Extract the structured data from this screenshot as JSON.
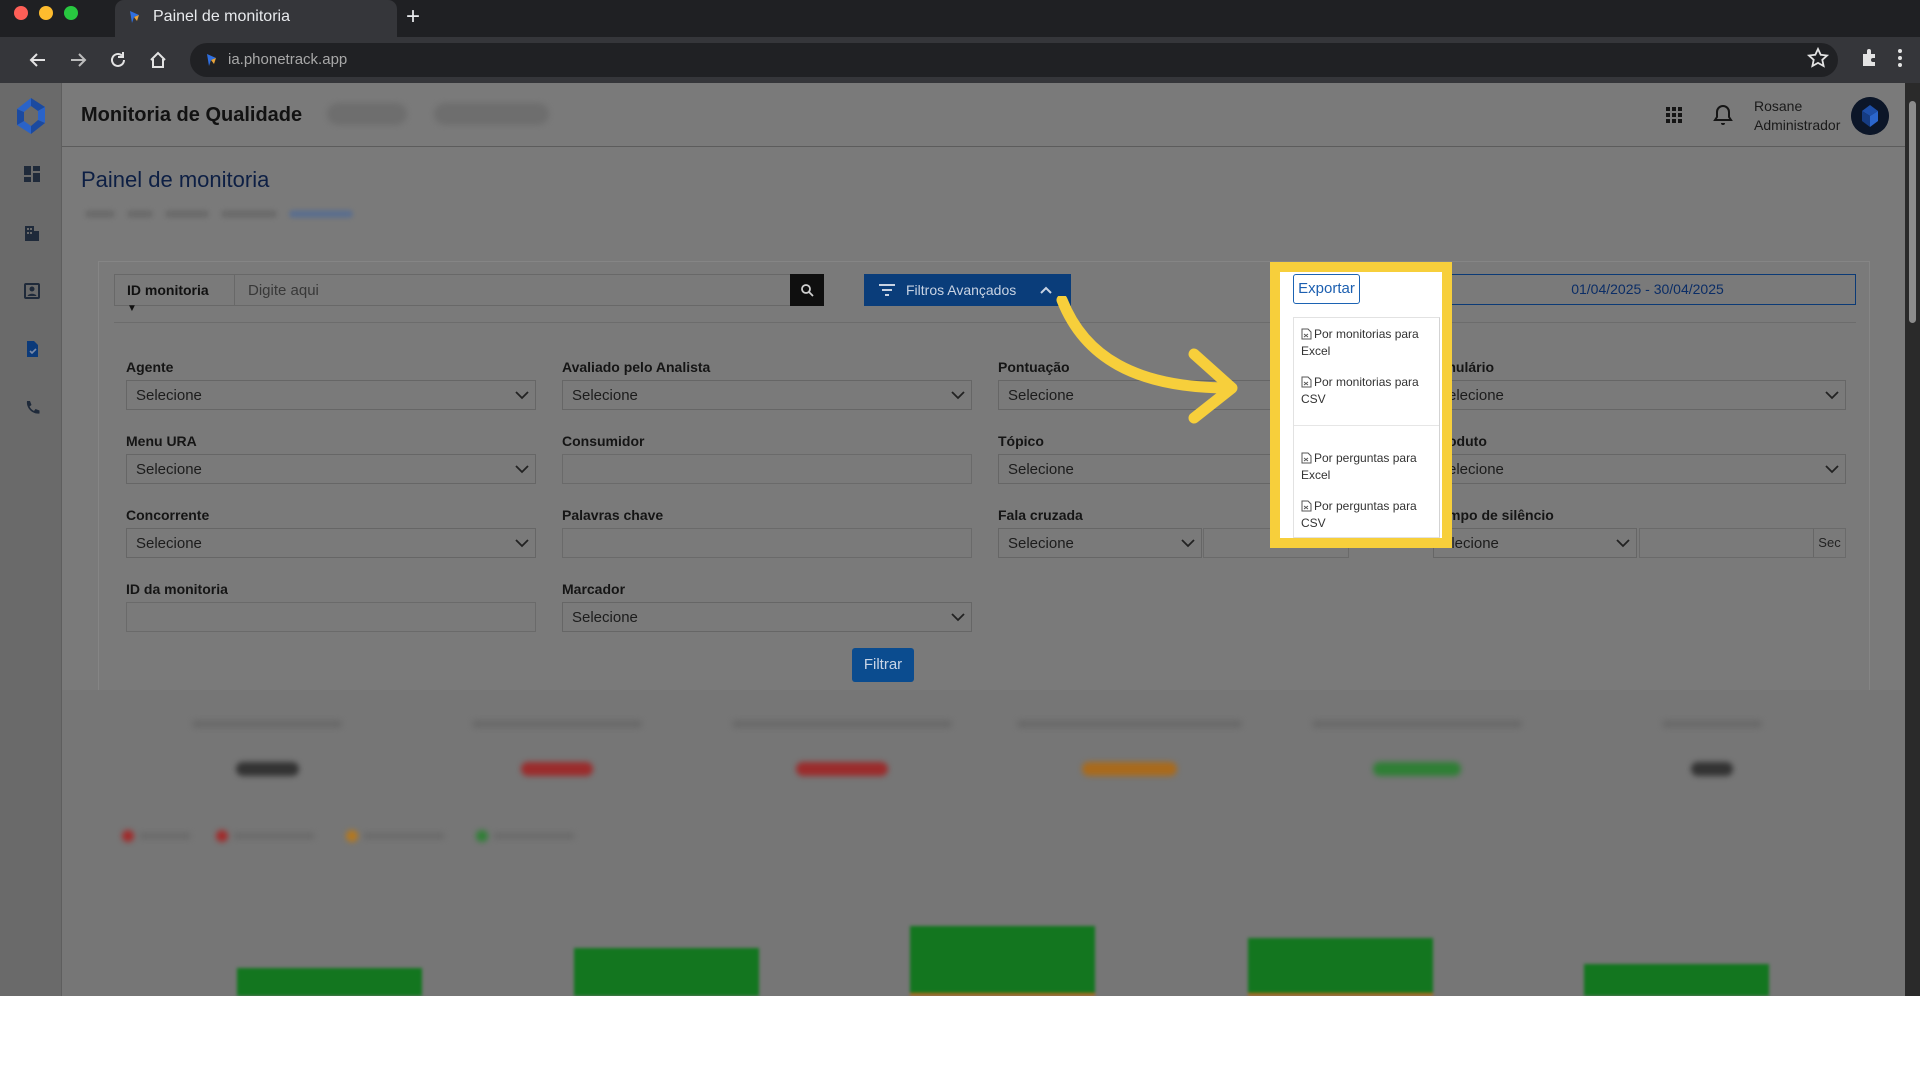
{
  "browser": {
    "tab_title": "Painel de monitoria",
    "url": "ia.phonetrack.app"
  },
  "header": {
    "app_title": "Monitoria de Qualidade",
    "user_name": "Rosane",
    "user_role": "Administrador"
  },
  "page": {
    "title": "Painel de monitoria"
  },
  "search": {
    "select_label": "ID monitoria",
    "placeholder": "Digite aqui",
    "advanced_filters_label": "Filtros Avançados",
    "date_range": "01/04/2025 - 30/04/2025"
  },
  "export": {
    "button_label": "Exportar",
    "items": [
      "Por monitorias para Excel",
      "Por monitorias para CSV",
      "Por perguntas para Excel",
      "Por perguntas para CSV"
    ]
  },
  "filters": {
    "select_placeholder": "Selecione",
    "agente": "Agente",
    "avaliado": "Avaliado pelo Analista",
    "pontuacao": "Pontuação",
    "formulario": "rmulário",
    "menu_ura": "Menu URA",
    "consumidor": "Consumidor",
    "topico": "Tópico",
    "produto": "oduto",
    "concorrente": "Concorrente",
    "palavras": "Palavras chave",
    "fala": "Fala cruzada",
    "silencio": "mpo de silêncio",
    "silencio_select": "elecione",
    "sec_unit": "Sec",
    "id_monitoria": "ID da monitoria",
    "marcador": "Marcador",
    "filter_button": "Filtrar"
  },
  "colors": {
    "highlight": "#f7cf3b",
    "primary": "#1c5fb0",
    "bar_green": "#13761f"
  }
}
